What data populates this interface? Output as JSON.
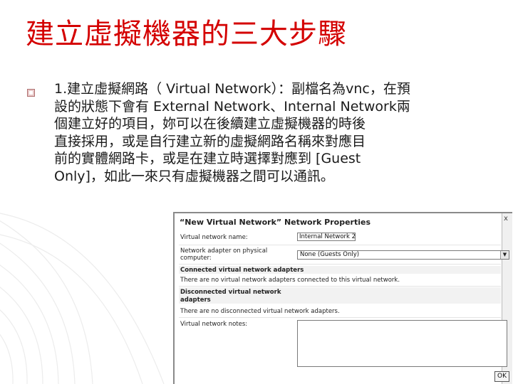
{
  "slide": {
    "title": "建立虛擬機器的三大步驟",
    "bullet_lines": [
      "1.建立虛擬網路（ Virtual Network）：副檔名為vnc，在預",
      "設的狀態下會有 External Network、Internal Network兩",
      "個建立好的項目，妳可以在後續建立虛擬機器的時後",
      "直接採用，或是自行建立新的虛擬網路名稱來對應目",
      "前的實體網路卡，或是在建立時選擇對應到 [Guest",
      "Only]，如此一來只有虛擬機器之間可以通訊。"
    ]
  },
  "dialog": {
    "title": "“New Virtual Network” Network Properties",
    "close_glyph": "x",
    "name_label": "Virtual network name:",
    "name_value": "Internal Network 2",
    "adapter_label_line1": "Network adapter on physical",
    "adapter_label_line2": "computer:",
    "adapter_value": "None (Guests Only)",
    "connected_header": "Connected virtual network adapters",
    "connected_text": "There are no virtual network adapters connected to this virtual network.",
    "disconnected_header_line1": "Disconnected virtual network",
    "disconnected_header_line2": "adapters",
    "disconnected_text": "There are no disconnected virtual network adapters.",
    "notes_label": "Virtual network notes:",
    "ok_label": "OK"
  }
}
